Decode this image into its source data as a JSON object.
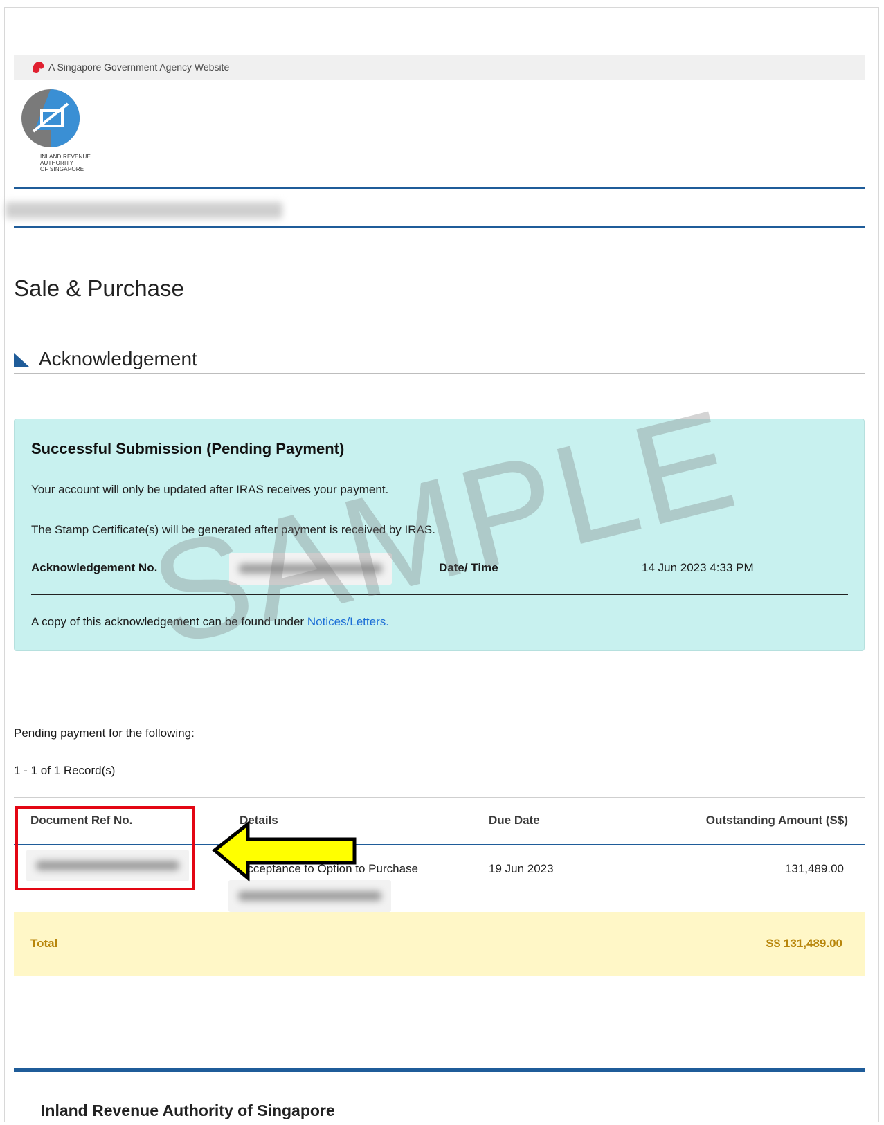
{
  "gov_banner": {
    "text": "A Singapore Government Agency Website"
  },
  "logo": {
    "caption": "INLAND REVENUE AUTHORITY OF SINGAPORE"
  },
  "page": {
    "title": "Sale & Purchase",
    "section": "Acknowledgement"
  },
  "success": {
    "title": "Successful Submission (Pending Payment)",
    "line1": "Your account will only be updated after IRAS receives your payment.",
    "line2": "The Stamp Certificate(s) will be generated after payment is received by IRAS.",
    "ack_label": "Acknowledgement No.",
    "datetime_label": "Date/ Time",
    "datetime_value": "14 Jun 2023 4:33 PM",
    "copy_prefix": "A copy of this acknowledgement can be found under",
    "copy_link": "Notices/Letters."
  },
  "watermark": "SAMPLE",
  "pending": {
    "intro": "Pending payment for the following:",
    "records": "1 - 1 of 1 Record(s)",
    "headers": [
      "Document Ref No.",
      "Details",
      "Due Date",
      "Outstanding Amount (S$)"
    ],
    "row": {
      "details": "Acceptance to Option to Purchase",
      "due_date": "19 Jun 2023",
      "amount": "131,489.00"
    },
    "total_label": "Total",
    "total_value": "S$ 131,489.00"
  },
  "footer": {
    "title": "Inland Revenue Authority of Singapore"
  },
  "colors": {
    "accent": "#1f5c99",
    "success_bg": "#c8f1ef",
    "total_bg": "#fff7c7",
    "highlight": "#e30613",
    "arrow": "#ffff00"
  }
}
